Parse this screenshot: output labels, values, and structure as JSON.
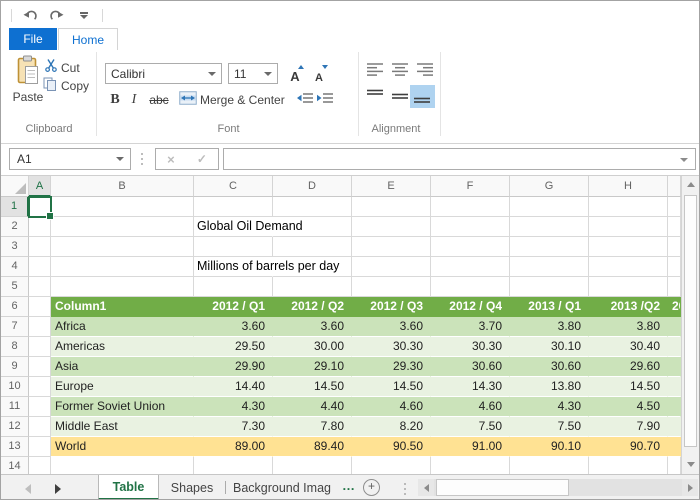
{
  "window": {
    "app": "spreadsheet"
  },
  "quick_access_toolbar": {
    "buttons": [
      {
        "name": "undo",
        "icon": "curved-arrow-left"
      },
      {
        "name": "redo",
        "icon": "curved-arrow-right"
      },
      {
        "name": "customize-quick-access-toolbar",
        "icon": "bar-chevron-down"
      }
    ]
  },
  "ribbon": {
    "tabs": [
      {
        "label": "File",
        "style": "filled-blue"
      },
      {
        "label": "Home",
        "selected": true
      }
    ],
    "clipboard": {
      "label": "Clipboard",
      "paste_label": "Paste",
      "cut_label": "Cut",
      "copy_label": "Copy"
    },
    "font": {
      "label": "Font",
      "font_name": "Calibri",
      "font_size": "11",
      "bold": "B",
      "italic": "I",
      "strikethrough": "abc",
      "merge_center_label": "Merge & Center"
    },
    "alignment": {
      "label": "Alignment",
      "selected_button": "bottom-align"
    }
  },
  "formula_bar": {
    "name_box_value": "A1",
    "cancel": "×",
    "enter": "✓",
    "formula_value": ""
  },
  "sheet": {
    "column_headers": [
      "A",
      "B",
      "C",
      "D",
      "E",
      "F",
      "G",
      "H"
    ],
    "visible_rows": [
      "1",
      "2",
      "3",
      "4",
      "5",
      "6",
      "7",
      "8",
      "9",
      "10",
      "11",
      "12",
      "13",
      "14"
    ],
    "selected_cell": "A1",
    "cells": {
      "C2": "Global Oil Demand",
      "C4": "Millions of barrels per day"
    },
    "table": {
      "headers": [
        "Column1",
        "2012 / Q1",
        "2012 / Q2",
        "2012 / Q3",
        "2012 / Q4",
        "2013 / Q1",
        "2013 /Q2",
        "20"
      ],
      "rows": [
        {
          "label": "Africa",
          "values": [
            "3.60",
            "3.60",
            "3.60",
            "3.70",
            "3.80",
            "3.80"
          ]
        },
        {
          "label": "Americas",
          "values": [
            "29.50",
            "30.00",
            "30.30",
            "30.30",
            "30.10",
            "30.40"
          ]
        },
        {
          "label": "Asia",
          "values": [
            "29.90",
            "29.10",
            "29.30",
            "30.60",
            "30.60",
            "29.60"
          ]
        },
        {
          "label": "Europe",
          "values": [
            "14.40",
            "14.50",
            "14.50",
            "14.30",
            "13.80",
            "14.50"
          ]
        },
        {
          "label": "Former Soviet Union",
          "values": [
            "4.30",
            "4.40",
            "4.60",
            "4.60",
            "4.30",
            "4.50"
          ]
        },
        {
          "label": "Middle East",
          "values": [
            "7.30",
            "7.80",
            "8.20",
            "7.50",
            "7.50",
            "7.90"
          ]
        },
        {
          "label": "World",
          "highlight": true,
          "values": [
            "89.00",
            "89.40",
            "90.50",
            "91.00",
            "90.10",
            "90.70"
          ]
        }
      ]
    }
  },
  "sheet_tabs": {
    "tabs": [
      {
        "label": "Table",
        "active": true
      },
      {
        "label": "Shapes",
        "active": false
      },
      {
        "label": "Background Imag",
        "active": false,
        "truncated": true
      }
    ],
    "more_indicator": "…",
    "add_sheet": "+"
  },
  "colors": {
    "accent_green": "#217346",
    "table_header_green": "#71AD47",
    "band_dark": "#CBE3BA",
    "band_light": "#E9F2E1",
    "world_row_yellow": "#FFE293",
    "file_tab_blue": "#0E70D1",
    "ribbon_icon_blue": "#2E75B6"
  }
}
